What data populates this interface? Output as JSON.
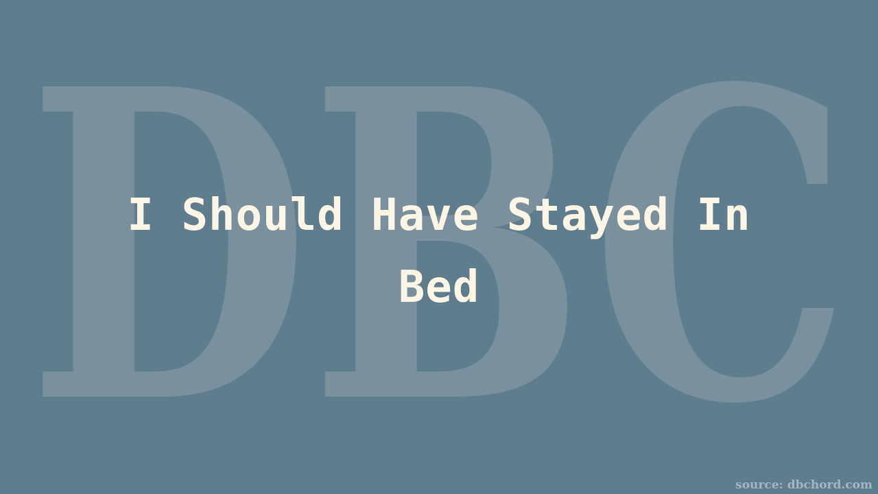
{
  "watermark": {
    "text": "DBC",
    "color": "#7a909c"
  },
  "slide": {
    "title": "I Should Have Stayed In Bed",
    "background_color": "#607d8e",
    "title_color": "#fdf5e6"
  },
  "footer": {
    "source": "source: dbchord.com"
  }
}
